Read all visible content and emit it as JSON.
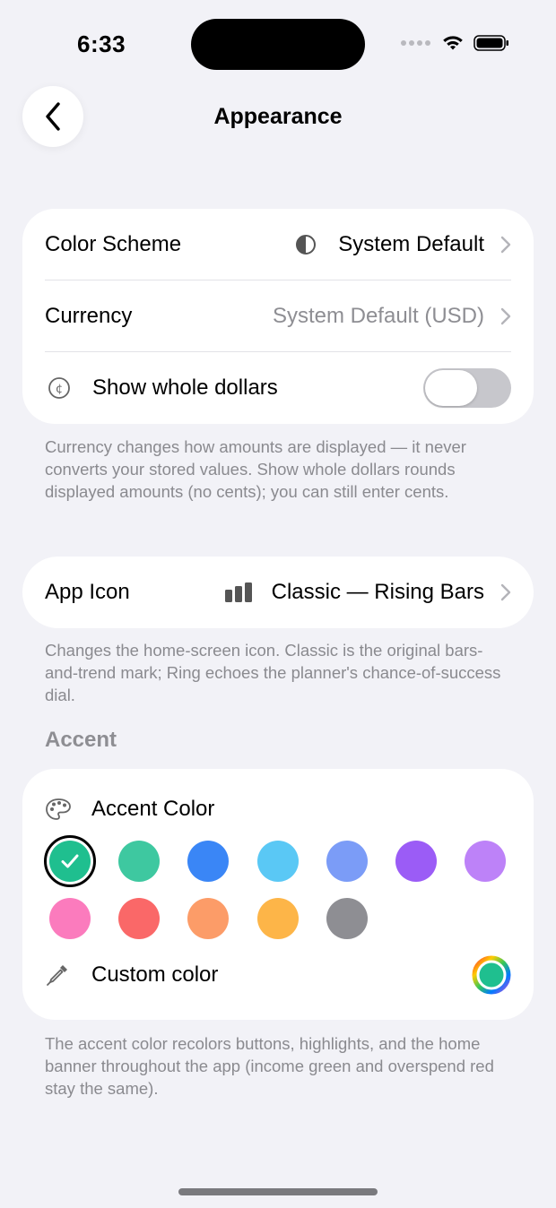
{
  "status_bar": {
    "time": "6:33"
  },
  "nav": {
    "title": "Appearance"
  },
  "settings_group": {
    "color_scheme": {
      "label": "Color Scheme",
      "value": "System Default"
    },
    "currency": {
      "label": "Currency",
      "value": "System Default (USD)"
    },
    "whole_dollars": {
      "label": "Show whole dollars",
      "enabled": false
    }
  },
  "currency_footnote": "Currency changes how amounts are displayed — it never converts your stored values. Show whole dollars rounds displayed amounts (no cents); you can still enter cents.",
  "app_icon": {
    "label": "App Icon",
    "value": "Classic — Rising Bars"
  },
  "app_icon_footnote": "Changes the home-screen icon. Classic is the original bars-and-trend mark; Ring echoes the planner's chance-of-success dial.",
  "accent_section": {
    "header": "Accent",
    "accent_label": "Accent Color",
    "custom_label": "Custom color",
    "selected_index": 0,
    "swatches": [
      {
        "name": "teal-green",
        "color": "#1fbf8f"
      },
      {
        "name": "mint",
        "color": "#3ec8a0"
      },
      {
        "name": "blue",
        "color": "#3a86f6"
      },
      {
        "name": "sky",
        "color": "#5ac8f5"
      },
      {
        "name": "periwinkle",
        "color": "#7b9cf7"
      },
      {
        "name": "purple",
        "color": "#9b5cf6"
      },
      {
        "name": "lavender",
        "color": "#bd82f8"
      },
      {
        "name": "pink",
        "color": "#fb7bbd"
      },
      {
        "name": "red",
        "color": "#fa6868"
      },
      {
        "name": "orange",
        "color": "#fc9c68"
      },
      {
        "name": "amber",
        "color": "#fdb548"
      },
      {
        "name": "gray",
        "color": "#8e8e93"
      }
    ]
  },
  "accent_footnote": "The accent color recolors buttons, highlights, and the home banner throughout the app (income green and overspend red stay the same)."
}
